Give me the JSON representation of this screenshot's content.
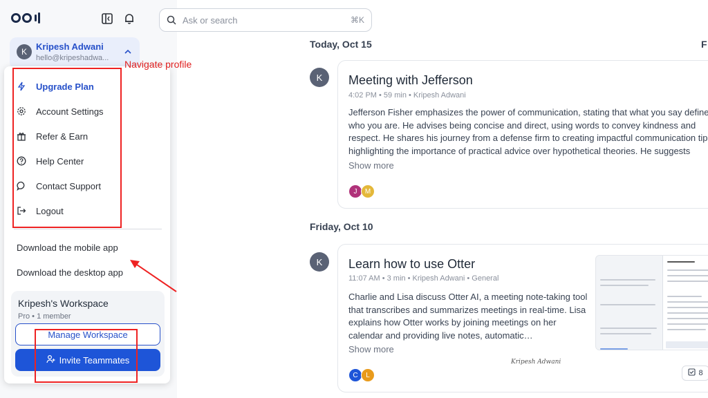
{
  "sidebar": {
    "user": {
      "initial": "K",
      "name": "Kripesh Adwani",
      "email": "hello@kripeshadwa..."
    },
    "menu": [
      {
        "label": "Upgrade Plan",
        "icon": "lightning-icon"
      },
      {
        "label": "Account Settings",
        "icon": "gear-icon"
      },
      {
        "label": "Refer & Earn",
        "icon": "gift-icon"
      },
      {
        "label": "Help Center",
        "icon": "help-circle-icon"
      },
      {
        "label": "Contact Support",
        "icon": "chat-bubble-icon"
      },
      {
        "label": "Logout",
        "icon": "logout-icon"
      }
    ],
    "downloads": {
      "mobile": "Download the mobile app",
      "desktop": "Download the desktop app"
    },
    "workspace": {
      "title": "Kripesh's Workspace",
      "subtitle": "Pro • 1 member",
      "manage_label": "Manage Workspace",
      "invite_label": "Invite Teammates"
    }
  },
  "annotation": {
    "text": "Navigate profile"
  },
  "search": {
    "placeholder": "Ask or search",
    "shortcut": "⌘K"
  },
  "feed": {
    "days": [
      {
        "label": "Today, Oct 15",
        "meetings": [
          {
            "avatar": "K",
            "title": "Meeting with Jefferson",
            "meta": "4:02 PM • 59 min • Kripesh Adwani",
            "body": "Jefferson Fisher emphasizes the power of communication, stating that what you say defines who you are. He advises being concise and direct, using words to convey kindness and respect. He shares his journey from a defense firm to creating impactful communication tips, highlighting the importance of practical advice over hypothetical theories. He suggests framing conversations",
            "show_more": "Show more",
            "participants": [
              "J",
              "M"
            ]
          }
        ]
      },
      {
        "label": "Friday, Oct 10",
        "meetings": [
          {
            "avatar": "K",
            "title": "Learn how to use Otter",
            "meta": "11:07 AM • 3 min • Kripesh Adwani • General",
            "body": "Charlie and Lisa discuss Otter AI, a meeting note-taking tool that transcribes and summarizes meetings in real-time. Lisa explains how Otter works by joining meetings on her calendar and providing live notes, automatic…",
            "show_more": "Show more",
            "participants": [
              "C",
              "L"
            ],
            "signature": "Kripesh Adwani",
            "action_count": "8"
          }
        ]
      }
    ],
    "next_day_partial": "F"
  },
  "colors": {
    "accent": "#1e55d8",
    "link": "#2650c9",
    "annotation": "#e22222"
  }
}
